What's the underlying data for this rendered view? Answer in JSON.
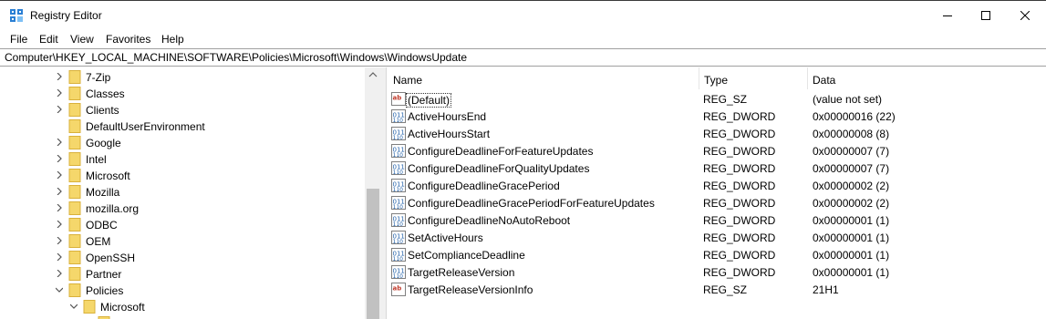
{
  "window": {
    "title": "Registry Editor",
    "icon": "registry-editor-icon",
    "controls": [
      "minimize-icon",
      "maximize-icon",
      "close-icon"
    ]
  },
  "menu": [
    "File",
    "Edit",
    "View",
    "Favorites",
    "Help"
  ],
  "address": "Computer\\HKEY_LOCAL_MACHINE\\SOFTWARE\\Policies\\Microsoft\\Windows\\WindowsUpdate",
  "tree": [
    {
      "label": "7-Zip",
      "state": "collapsed"
    },
    {
      "label": "Classes",
      "state": "collapsed"
    },
    {
      "label": "Clients",
      "state": "collapsed"
    },
    {
      "label": "DefaultUserEnvironment",
      "state": "none"
    },
    {
      "label": "Google",
      "state": "collapsed"
    },
    {
      "label": "Intel",
      "state": "collapsed"
    },
    {
      "label": "Microsoft",
      "state": "collapsed"
    },
    {
      "label": "Mozilla",
      "state": "collapsed"
    },
    {
      "label": "mozilla.org",
      "state": "collapsed"
    },
    {
      "label": "ODBC",
      "state": "collapsed"
    },
    {
      "label": "OEM",
      "state": "collapsed"
    },
    {
      "label": "OpenSSH",
      "state": "collapsed"
    },
    {
      "label": "Partner",
      "state": "collapsed"
    },
    {
      "label": "Policies",
      "state": "expanded"
    },
    {
      "label": "Microsoft",
      "state": "expanded",
      "child": true
    }
  ],
  "columns": {
    "name": "Name",
    "type": "Type",
    "data": "Data"
  },
  "values": [
    {
      "name": "(Default)",
      "type": "REG_SZ",
      "data": "(value not set)",
      "icon": "string-value-icon"
    },
    {
      "name": "ActiveHoursEnd",
      "type": "REG_DWORD",
      "data": "0x00000016 (22)",
      "icon": "binary-value-icon"
    },
    {
      "name": "ActiveHoursStart",
      "type": "REG_DWORD",
      "data": "0x00000008 (8)",
      "icon": "binary-value-icon"
    },
    {
      "name": "ConfigureDeadlineForFeatureUpdates",
      "type": "REG_DWORD",
      "data": "0x00000007 (7)",
      "icon": "binary-value-icon"
    },
    {
      "name": "ConfigureDeadlineForQualityUpdates",
      "type": "REG_DWORD",
      "data": "0x00000007 (7)",
      "icon": "binary-value-icon"
    },
    {
      "name": "ConfigureDeadlineGracePeriod",
      "type": "REG_DWORD",
      "data": "0x00000002 (2)",
      "icon": "binary-value-icon"
    },
    {
      "name": "ConfigureDeadlineGracePeriodForFeatureUpdates",
      "type": "REG_DWORD",
      "data": "0x00000002 (2)",
      "icon": "binary-value-icon"
    },
    {
      "name": "ConfigureDeadlineNoAutoReboot",
      "type": "REG_DWORD",
      "data": "0x00000001 (1)",
      "icon": "binary-value-icon"
    },
    {
      "name": "SetActiveHours",
      "type": "REG_DWORD",
      "data": "0x00000001 (1)",
      "icon": "binary-value-icon"
    },
    {
      "name": "SetComplianceDeadline",
      "type": "REG_DWORD",
      "data": "0x00000001 (1)",
      "icon": "binary-value-icon"
    },
    {
      "name": "TargetReleaseVersion",
      "type": "REG_DWORD",
      "data": "0x00000001 (1)",
      "icon": "binary-value-icon"
    },
    {
      "name": "TargetReleaseVersionInfo",
      "type": "REG_SZ",
      "data": "21H1",
      "icon": "string-value-icon"
    }
  ],
  "colors": {
    "folder": "#f5d76b",
    "folder_edge": "#d9b13b",
    "string_icon": "#c0392b",
    "binary_icon": "#1f5fa8"
  }
}
